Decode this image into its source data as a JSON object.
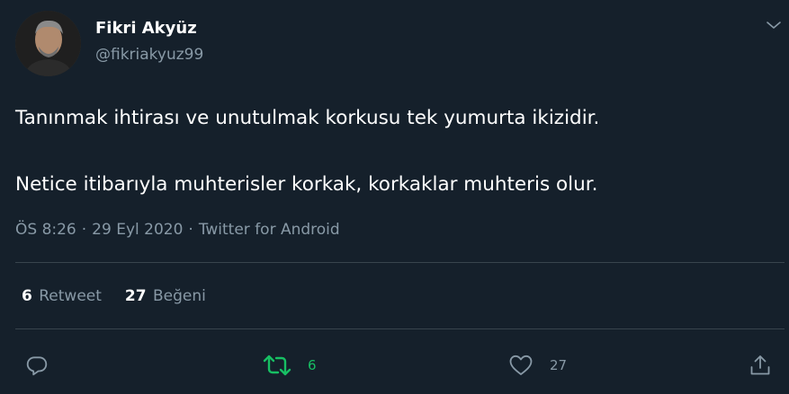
{
  "author": {
    "display_name": "Fikri Akyüz",
    "handle": "@fikriakyuz99",
    "avatar_icon": "profile-photo"
  },
  "tweet": {
    "lines": [
      "Tanınmak ihtirası ve unutulmak korkusu tek yumurta ikizidir.",
      "Netice itibarıyla muhterisler korkak, korkaklar muhteris olur."
    ],
    "time": "ÖS 8:26",
    "date": "29 Eyl 2020",
    "source": "Twitter for Android",
    "separator": "·"
  },
  "stats": {
    "retweets": "6",
    "retweets_label": "Retweet",
    "likes": "27",
    "likes_label": "Beğeni"
  },
  "actions": {
    "reply_icon": "reply-icon",
    "retweet_icon": "retweet-icon",
    "retweet_count": "6",
    "like_icon": "heart-icon",
    "like_count": "27",
    "share_icon": "share-icon"
  },
  "colors": {
    "background": "#15202b",
    "secondary_text": "#8899a6",
    "divider": "#38444d",
    "retweet_active": "#17bf63"
  }
}
